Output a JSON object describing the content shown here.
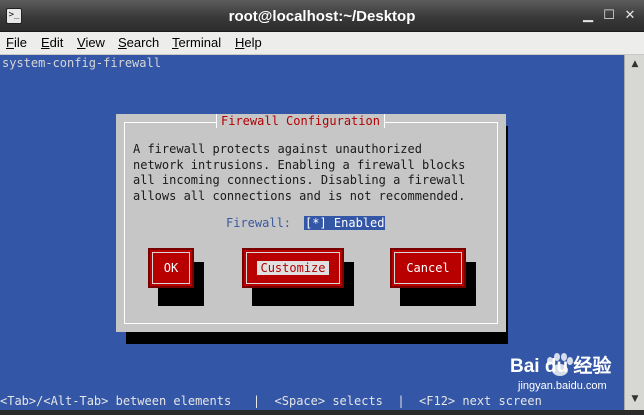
{
  "window": {
    "title": "root@localhost:~/Desktop",
    "icon": "terminal-icon",
    "controls": [
      "minimize-icon",
      "maximize-icon",
      "close-icon"
    ]
  },
  "menubar": {
    "items": [
      {
        "label": "File",
        "mnemonic": "F",
        "rest": "ile"
      },
      {
        "label": "Edit",
        "mnemonic": "E",
        "rest": "dit"
      },
      {
        "label": "View",
        "mnemonic": "V",
        "rest": "iew"
      },
      {
        "label": "Search",
        "mnemonic": "S",
        "rest": "earch"
      },
      {
        "label": "Terminal",
        "mnemonic": "T",
        "rest": "erminal"
      },
      {
        "label": "Help",
        "mnemonic": "H",
        "rest": "elp"
      }
    ]
  },
  "terminal": {
    "app_name": "system-config-firewall",
    "dialog": {
      "title": "Firewall Configuration",
      "body": "A firewall protects against unauthorized\nnetwork intrusions. Enabling a firewall blocks\nall incoming connections. Disabling a firewall\nallows all connections and is not recommended.",
      "field_label": "Firewall:",
      "field_value": "[*] Enabled",
      "buttons": {
        "ok": "OK",
        "customize": "Customize",
        "cancel": "Cancel"
      }
    },
    "hints": "<Tab>/<Alt-Tab> between elements   |  <Space> selects  |  <F12> next screen"
  },
  "watermark": {
    "brand": "Bai du 经验",
    "url": "jingyan.baidu.com"
  },
  "colors": {
    "terminal_bg": "#3356a6",
    "dialog_bg": "#c6c6c6",
    "button_red": "#b80000",
    "title_red": "#b40000"
  }
}
